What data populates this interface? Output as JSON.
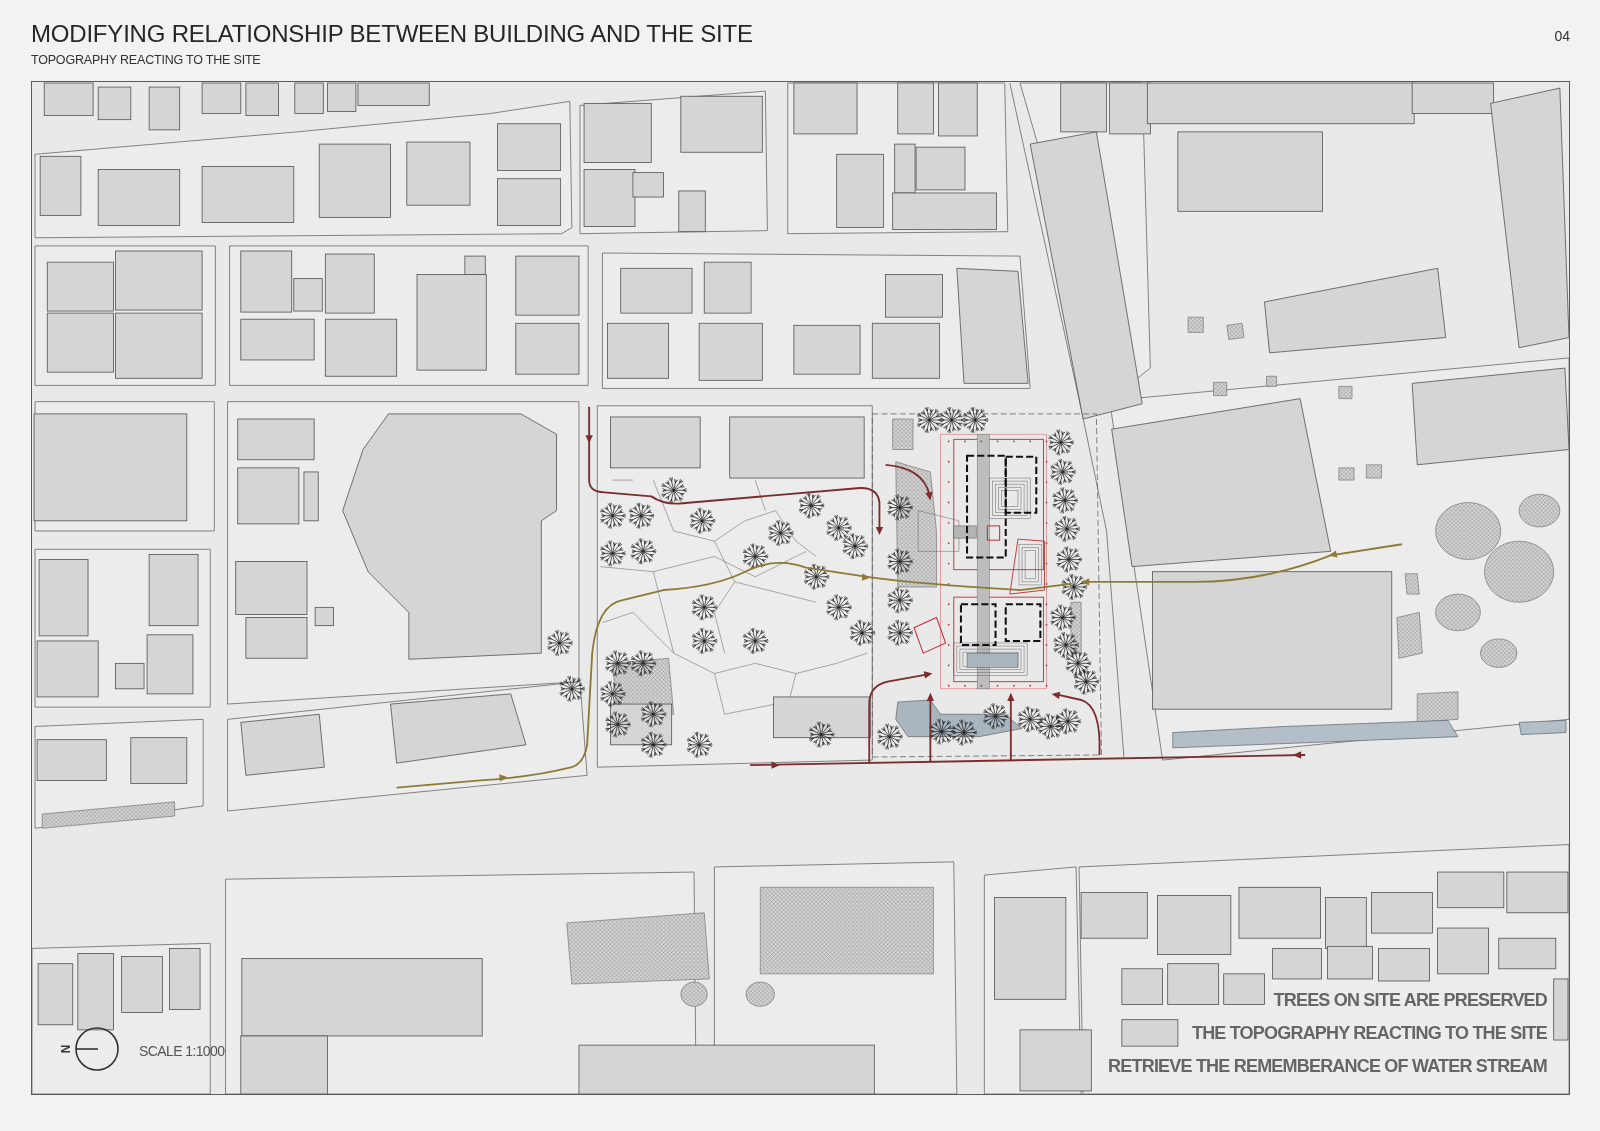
{
  "header": {
    "title": "MODIFYING RELATIONSHIP BETWEEN BUILDING AND THE SITE",
    "subtitle": "TOPOGRAPHY REACTING TO THE SITE",
    "page_number": "04"
  },
  "site_plan": {
    "north_label": "N",
    "scale": "SCALE 1:1000",
    "notes": [
      "TREES ON SITE ARE PRESERVED",
      "THE TOPOGRAPHY REACTING TO THE SITE",
      "RETRIEVE THE REMEMBERANCE OF WATER STREAM"
    ]
  }
}
